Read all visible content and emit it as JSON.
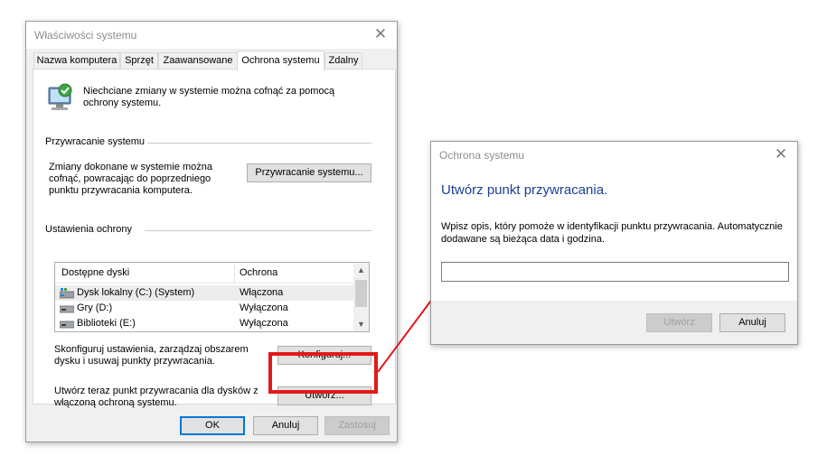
{
  "sysprops": {
    "title": "Właściwości systemu",
    "tabs": [
      {
        "label": "Nazwa komputera"
      },
      {
        "label": "Sprzęt"
      },
      {
        "label": "Zaawansowane"
      },
      {
        "label": "Ochrona systemu"
      },
      {
        "label": "Zdalny"
      }
    ],
    "active_tab": "Ochrona systemu",
    "intro": "Niechciane zmiany w systemie można cofnąć za pomocą ochrony systemu.",
    "restore": {
      "section_title": "Przywracanie systemu",
      "text": "Zmiany dokonane w systemie można cofnąć, powracając do poprzedniego punktu przywracania komputera.",
      "button_label": "Przywracanie systemu..."
    },
    "protection": {
      "section_title": "Ustawienia ochrony",
      "columns": [
        "Dostępne dyski",
        "Ochrona"
      ],
      "drives": [
        {
          "name": "Dysk lokalny (C:) (System)",
          "status": "Włączona",
          "icon": "system-drive-icon"
        },
        {
          "name": "Gry (D:)",
          "status": "Wyłączona",
          "icon": "drive-icon"
        },
        {
          "name": "Biblioteki (E:)",
          "status": "Wyłączona",
          "icon": "drive-icon"
        }
      ],
      "configure_text": "Skonfiguruj ustawienia, zarządzaj obszarem dysku i usuwaj punkty przywracania.",
      "configure_button": "Konfiguruj...",
      "create_text": "Utwórz teraz punkt przywracania dla dysków z włączoną ochroną systemu.",
      "create_button": "Utwórz..."
    },
    "buttons": {
      "ok": "OK",
      "cancel": "Anuluj",
      "apply": "Zastosuj"
    }
  },
  "dialog": {
    "title": "Ochrona systemu",
    "heading": "Utwórz punkt przywracania.",
    "description": "Wpisz opis, który pomoże w identyfikacji punktu przywracania. Automatycznie dodawane są bieżąca data i godzina.",
    "input_value": "",
    "buttons": {
      "create": "Utwórz",
      "cancel": "Anuluj"
    }
  },
  "colors": {
    "annotation": "#e11a1a",
    "heading": "#1c3f94",
    "focus": "#0078d7"
  }
}
